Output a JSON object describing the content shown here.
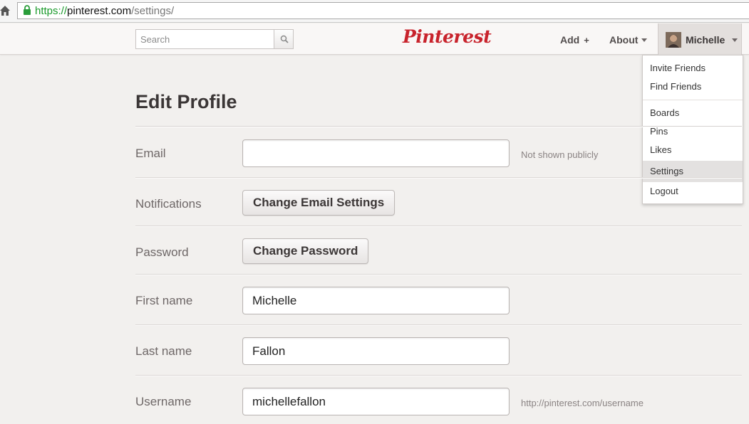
{
  "browser": {
    "url_scheme": "https://",
    "url_host": "pinterest.com",
    "url_path": "/settings/"
  },
  "header": {
    "search_placeholder": "Search",
    "logo": "Pinterest",
    "add_label": "Add",
    "add_plus": "+",
    "about_label": "About",
    "user_name": "Michelle"
  },
  "dropdown": {
    "items": [
      {
        "label": "Invite Friends"
      },
      {
        "label": "Find Friends"
      },
      {
        "label": "Boards"
      },
      {
        "label": "Pins"
      },
      {
        "label": "Likes"
      },
      {
        "label": "Settings",
        "active": true
      },
      {
        "label": "Logout"
      }
    ]
  },
  "page": {
    "title": "Edit Profile",
    "email": {
      "label": "Email",
      "value": "",
      "hint": "Not shown publicly"
    },
    "notifications": {
      "label": "Notifications",
      "button": "Change Email Settings"
    },
    "password": {
      "label": "Password",
      "button": "Change Password"
    },
    "first_name": {
      "label": "First name",
      "value": "Michelle"
    },
    "last_name": {
      "label": "Last name",
      "value": "Fallon"
    },
    "username": {
      "label": "Username",
      "value": "michellefallon",
      "hint": "http://pinterest.com/username"
    }
  },
  "colors": {
    "brand_red": "#c8232c",
    "url_green": "#1a9a2b",
    "background": "#f2f0ee"
  }
}
